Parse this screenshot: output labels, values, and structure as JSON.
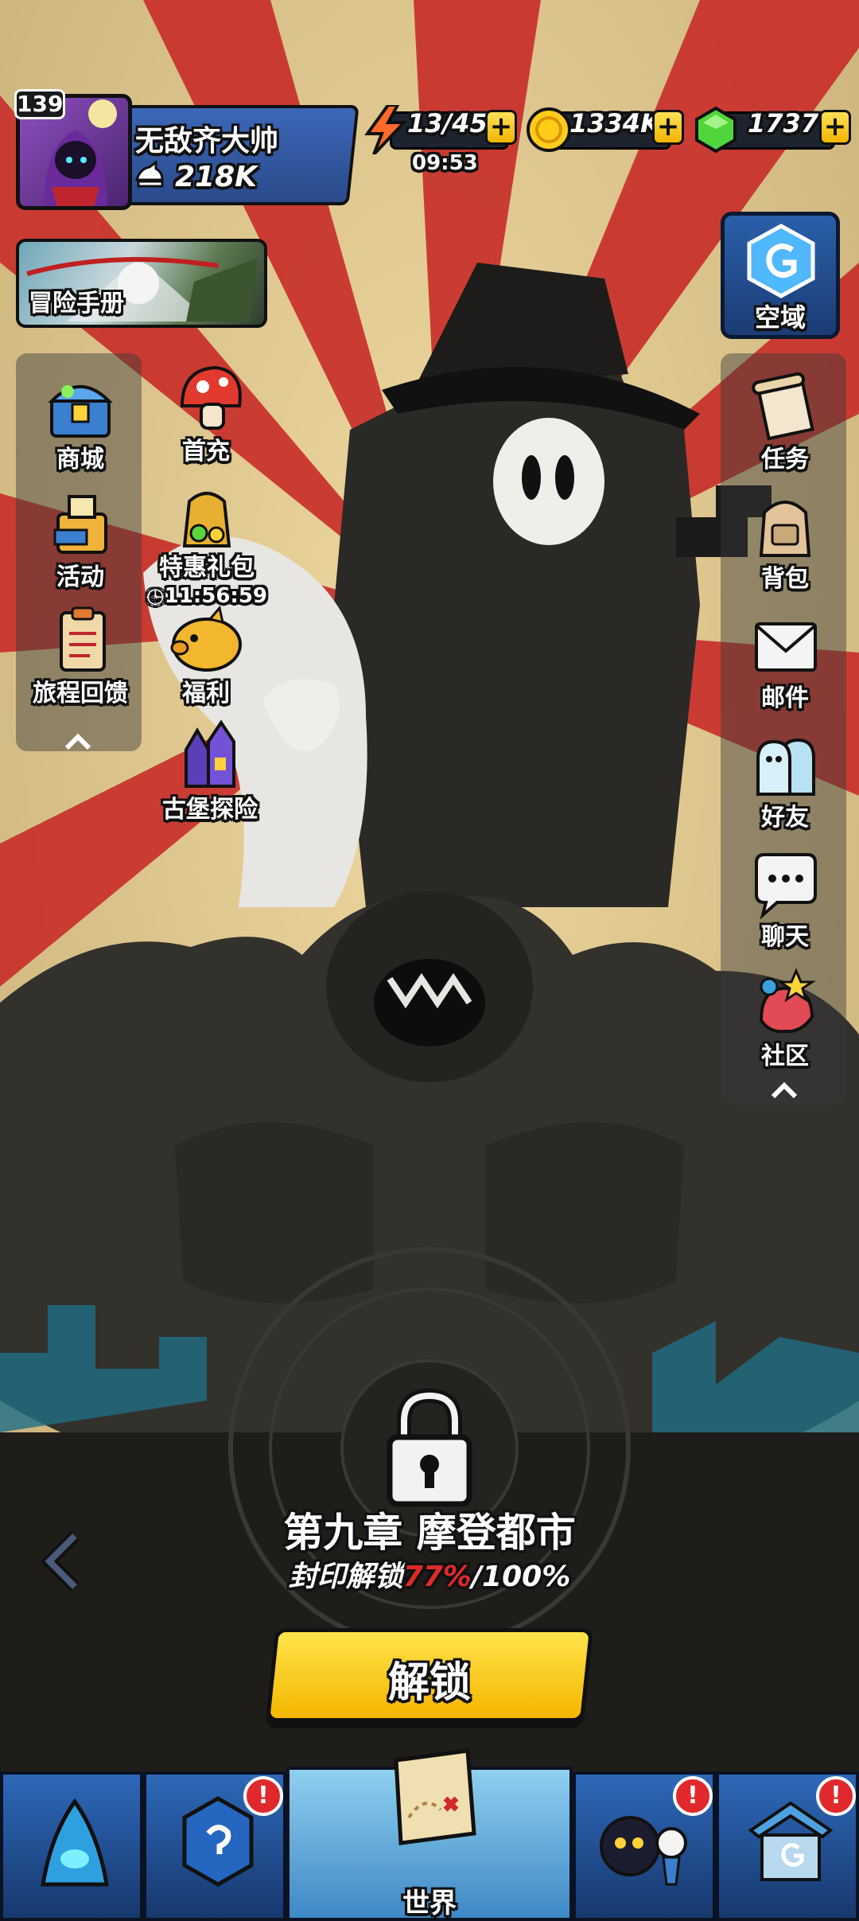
{
  "profile": {
    "level": "139",
    "name": "无敌齐大帅",
    "power": "218K"
  },
  "resources": {
    "energy": {
      "value": "13/45",
      "timer": "09:53",
      "plus": "+"
    },
    "coins": {
      "value": "1334K",
      "plus": "+"
    },
    "gems": {
      "value": "1737",
      "plus": "+"
    }
  },
  "left_menu": {
    "adventure_book": "冒险手册",
    "shop": "商城",
    "first_recharge": "首充",
    "events": "活动",
    "special_pack": "特惠礼包",
    "special_pack_timer": "11:56:59",
    "journey_feedback": "旅程回馈",
    "welfare": "福利",
    "castle_adventure": "古堡探险"
  },
  "right_menu": {
    "void_realm": "空域",
    "quests": "任务",
    "backpack": "背包",
    "mail": "邮件",
    "friends": "好友",
    "chat": "聊天",
    "community": "社区"
  },
  "chapter": {
    "title": "第九章 摩登都市",
    "progress_prefix": "封印解锁",
    "progress_value": "77%",
    "progress_total": "/100%",
    "unlock_label": "解锁"
  },
  "nav": {
    "world_label": "世界",
    "badge": "!"
  },
  "colors": {
    "ray_red": "#c8302b",
    "ray_yellow": "#e7c56a",
    "accent_yellow": "#f5b600",
    "progress_red": "#e02a2a",
    "nav_blue": "#2e68b8"
  }
}
